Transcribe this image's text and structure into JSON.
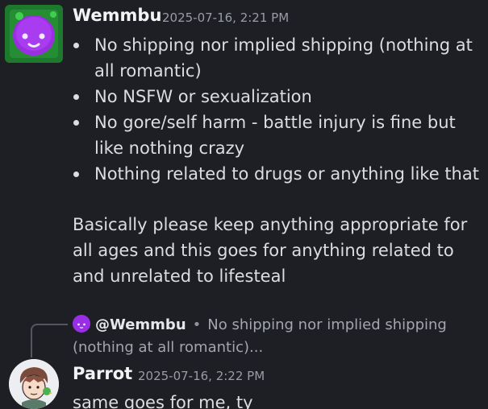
{
  "message1": {
    "author": "Wemmbu",
    "timestamp": "2025-07-16, 2:21 PM",
    "bullets": [
      "No shipping nor implied shipping (nothing at all romantic)",
      "No NSFW or sexualization",
      "No gore/self harm - battle injury is fine but like nothing crazy",
      "Nothing related to drugs or anything like that"
    ],
    "paragraph": "Basically please keep anything appropriate for all ages and this goes for anything related to and unrelated to lifesteal"
  },
  "message2": {
    "reply": {
      "author": "@Wemmbu",
      "separator": "•",
      "preview": "No shipping nor implied shipping (nothing at all romantic)..."
    },
    "author": "Parrot",
    "timestamp": "2025-07-16, 2:22 PM",
    "text": "same goes for me, ty"
  }
}
